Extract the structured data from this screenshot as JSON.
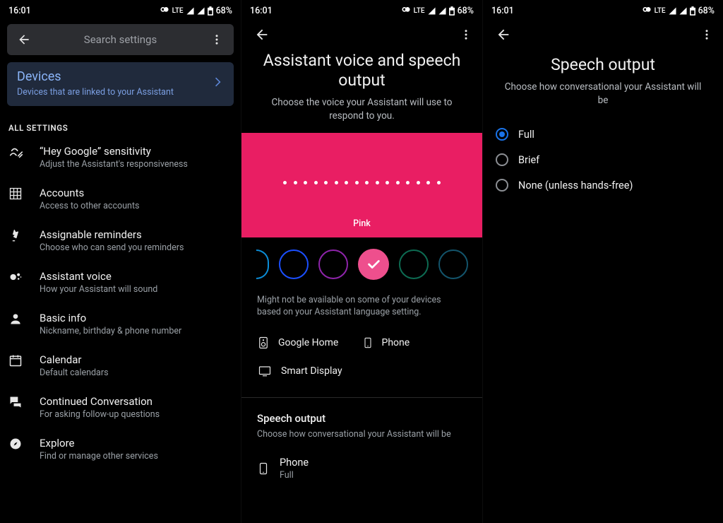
{
  "status": {
    "time": "16:01",
    "battery": "68%",
    "network": "LTE"
  },
  "p1": {
    "search_placeholder": "Search settings",
    "card": {
      "title": "Devices",
      "sub": "Devices that are linked to your Assistant"
    },
    "section": "ALL SETTINGS",
    "items": [
      {
        "t": "“Hey Google” sensitivity",
        "s": "Adjust the Assistant's responsiveness"
      },
      {
        "t": "Accounts",
        "s": "Access to other accounts"
      },
      {
        "t": "Assignable reminders",
        "s": "Choose who can send you reminders"
      },
      {
        "t": "Assistant voice",
        "s": "How your Assistant will sound"
      },
      {
        "t": "Basic info",
        "s": "Nickname, birthday & phone number"
      },
      {
        "t": "Calendar",
        "s": "Default calendars"
      },
      {
        "t": "Continued Conversation",
        "s": "For asking follow-up questions"
      },
      {
        "t": "Explore",
        "s": "Find or manage other services"
      }
    ]
  },
  "p2": {
    "title": "Assistant voice and speech output",
    "desc": "Choose the voice your Assistant will use to respond to you.",
    "voice_label": "Pink",
    "swatch_colors": [
      "#0b8dd8",
      "#1b4fff",
      "#8e24aa",
      "#ee4f8d",
      "#0d6b52",
      "#13546b"
    ],
    "note": "Might not be available on some of your devices based on your Assistant language setting.",
    "devices": [
      "Google Home",
      "Phone",
      "Smart Display"
    ],
    "speech": {
      "title": "Speech output",
      "desc": "Choose how conversational your Assistant will be",
      "phone": {
        "t": "Phone",
        "s": "Full"
      }
    }
  },
  "p3": {
    "title": "Speech output",
    "desc": "Choose how conversational your Assistant will be",
    "options": [
      "Full",
      "Brief",
      "None (unless hands-free)"
    ],
    "selected": 0
  }
}
